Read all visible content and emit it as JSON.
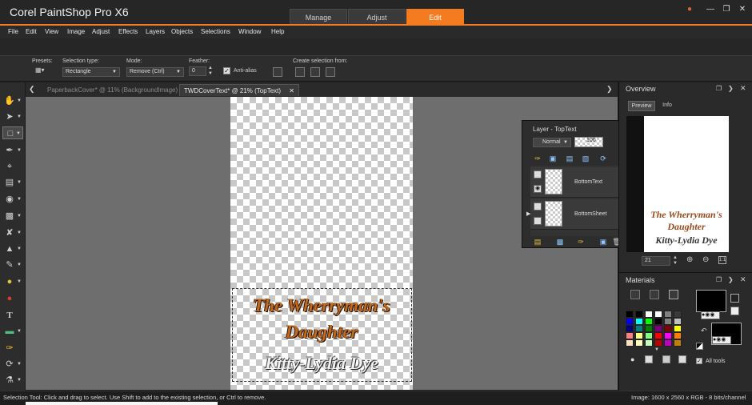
{
  "app": {
    "title": "Corel PaintShop Pro X6",
    "workspace_tabs": [
      "Manage",
      "Adjust",
      "Edit"
    ],
    "active_workspace": "Edit"
  },
  "menu": [
    "File",
    "Edit",
    "View",
    "Image",
    "Adjust",
    "Effects",
    "Layers",
    "Objects",
    "Selections",
    "Window",
    "Help"
  ],
  "options": {
    "presets_label": "Presets:",
    "selection_type_label": "Selection type:",
    "selection_type_value": "Rectangle",
    "mode_label": "Mode:",
    "mode_value": "Remove (Ctrl)",
    "feather_label": "Feather:",
    "feather_value": "0",
    "antialias_label": "Anti-alias",
    "create_from_label": "Create selection from:"
  },
  "doc_tabs": [
    {
      "label": "PaperbackCover* @  11% (BackgroundImage)",
      "active": false
    },
    {
      "label": "TWDCoverText* @  21% (TopText)",
      "active": true
    }
  ],
  "cover": {
    "title_line1": "The Wherryman's",
    "title_line2": "Daughter",
    "author": "Kitty-Lydia Dye"
  },
  "layers_palette": {
    "title": "Layer - TopText",
    "blend_mode": "Normal",
    "opacity": "100",
    "layers": [
      {
        "name": "BottomText"
      },
      {
        "name": "BottomSheet"
      }
    ]
  },
  "overview": {
    "title": "Overview",
    "tabs": [
      "Preview",
      "Info"
    ],
    "zoom_value": "21"
  },
  "materials": {
    "title": "Materials",
    "all_tools_label": "All tools",
    "swatches": [
      "#000000",
      "#000000",
      "#ffffff",
      "#ffffff",
      "#7f7f7f",
      "#3a3a3a",
      "#0000ff",
      "#00ffff",
      "#00ff00",
      "#000000",
      "#808080",
      "#c0c0c0",
      "#000080",
      "#008080",
      "#008000",
      "#800080",
      "#800000",
      "#ffff00",
      "#ff8080",
      "#ffff80",
      "#80ff80",
      "#ff0000",
      "#ff00ff",
      "#ff8000",
      "#ffe0c0",
      "#ffffc0",
      "#c0ffc0",
      "#c00000",
      "#c000c0",
      "#c08000"
    ]
  },
  "status": {
    "hint": "Selection Tool: Click and drag to select. Use Shift to add to the existing selection, or Ctrl to remove.",
    "image_info": "Image:  1600 x 2560 x RGB - 8 bits/channel"
  }
}
